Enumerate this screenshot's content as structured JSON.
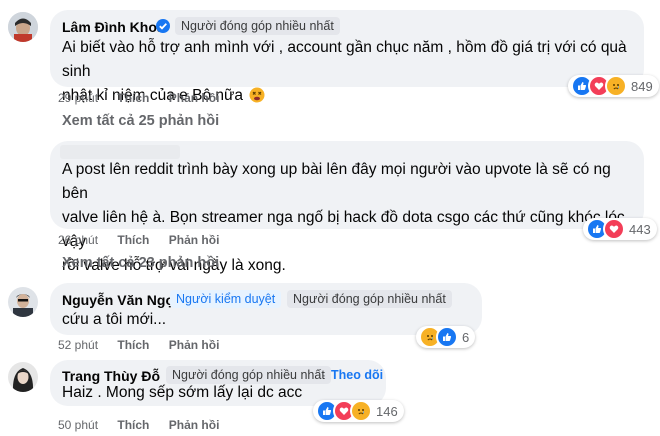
{
  "comments": [
    {
      "author": "Lâm Đình Khoa",
      "badges": [
        "Người đóng góp nhiều nhất"
      ],
      "text_line1": "Ai biết vào hỗ trợ anh mình với , account gần chục năm , hồm đồ giá trị với có quà sinh",
      "text_line2": "nhật kỉ niệm của e Bô nữa",
      "time": "29 phút",
      "like": "Thích",
      "reply": "Phản hồi",
      "reaction_count": "849",
      "reactions": [
        "like-icon",
        "love-icon",
        "sad-icon"
      ],
      "view_replies": "Xem tất cả 25 phản hồi"
    },
    {
      "author": "",
      "text_line1": "A post lên reddit trình bày xong up bài lên đây mọi người vào upvote là sẽ có ng bên",
      "text_line2": "valve liên hệ à. Bọn streamer nga ngố bị hack đồ dota csgo các thứ cũng khóc lóc vậy",
      "text_line3": "rồi valve hỗ trợ vài ngày là xong.",
      "time": "26 phút",
      "like": "Thích",
      "reply": "Phản hồi",
      "reaction_count": "443",
      "reactions": [
        "like-icon",
        "love-icon"
      ],
      "view_replies": "Xem tất cả 23 phản hồi"
    },
    {
      "author": "Nguyễn Văn Ngọc",
      "badges": [
        "Người kiểm duyệt",
        "Người đóng góp nhiều nhất"
      ],
      "text_line1": "cứu a tôi mới...",
      "time": "52 phút",
      "like": "Thích",
      "reply": "Phản hồi",
      "reaction_count": "6",
      "reactions": [
        "sad-icon",
        "like-icon"
      ]
    },
    {
      "author": "Trang Thùy Đỗ",
      "badges": [
        "Người đóng góp nhiều nhất"
      ],
      "follow": "Theo dõi",
      "separator": "·",
      "text_line1": "Haiz . Mong sếp sớm lấy lại dc acc",
      "time": "50 phút",
      "like": "Thích",
      "reply": "Phản hồi",
      "reaction_count": "146",
      "reactions": [
        "like-icon",
        "love-icon",
        "sad-icon"
      ]
    }
  ],
  "colors": {
    "like": "#1877f2",
    "love": "#f33e58",
    "sad": "#f7b125",
    "link": "#1877f2"
  }
}
